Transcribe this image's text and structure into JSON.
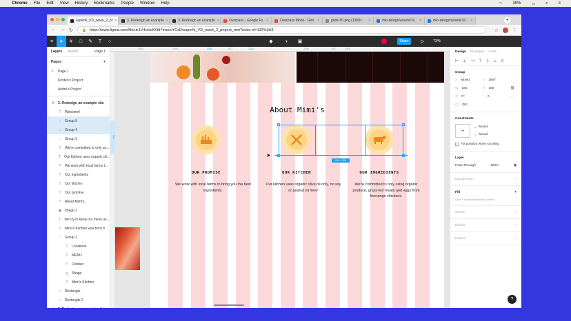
{
  "menubar": {
    "app": "Chrome",
    "items": [
      "File",
      "Edit",
      "View",
      "History",
      "Bookmarks",
      "People",
      "Window",
      "Help"
    ],
    "battery": "39%",
    "clock": "Q"
  },
  "browser": {
    "tabs": [
      {
        "label": "superhi_VD_week_2_pr",
        "color": "#1e1e1e",
        "active": true
      },
      {
        "label": "3. Redesign an example",
        "color": "#2b2b2b",
        "active": false
      },
      {
        "label": "3. Redesign an example",
        "color": "#2b2b2b",
        "active": false
      },
      {
        "label": "Overpass - Google Fo",
        "color": "#e9453a",
        "active": false
      },
      {
        "label": "Overpass Mono - Goo",
        "color": "#e9453a",
        "active": false
      },
      {
        "label": "grids-50.png (1300×",
        "color": "#888888",
        "active": false
      },
      {
        "label": "mio-design/assets/10",
        "color": "#1a73e8",
        "active": false
      },
      {
        "label": "mio-design/assets/10",
        "color": "#1a73e8",
        "active": false
      }
    ],
    "url": "https://www.figma.com/file/uk1V4cetcKKfd7mwcvYCsD/superhi_VD_week_2_project_mm?node-id=132%3A3"
  },
  "figma": {
    "file_title": "",
    "share_label": "Share",
    "zoom": "73%",
    "left_tabs": {
      "layers": "Layers",
      "assets": "Assets",
      "page": "Page 1"
    },
    "pages_label": "Pages",
    "pages": [
      "Page 1",
      "Kirsten's Project",
      "André's Project"
    ],
    "layers": [
      {
        "label": "3. Redesign an example site",
        "icon": "#",
        "indent": 0,
        "frame": true,
        "hl": false
      },
      {
        "label": "Welcome!",
        "icon": "T",
        "indent": 1,
        "frame": false,
        "hl": false
      },
      {
        "label": "Group 5",
        "icon": "::",
        "indent": 1,
        "frame": false,
        "hl": true
      },
      {
        "label": "Group 4",
        "icon": "::",
        "indent": 1,
        "frame": false,
        "hl": true
      },
      {
        "label": "Group 3",
        "icon": "::",
        "indent": 1,
        "frame": false,
        "hl": false
      },
      {
        "label": "We're committed to only us...",
        "icon": "T",
        "indent": 1,
        "frame": false,
        "hl": false
      },
      {
        "label": "Our kitchen uses organic oli...",
        "icon": "T",
        "indent": 1,
        "frame": false,
        "hl": false
      },
      {
        "label": "We work with local farms t...",
        "icon": "T",
        "indent": 1,
        "frame": false,
        "hl": false
      },
      {
        "label": "Our ingredients",
        "icon": "T",
        "indent": 1,
        "frame": false,
        "hl": false
      },
      {
        "label": "Our kitchen",
        "icon": "T",
        "indent": 1,
        "frame": false,
        "hl": false
      },
      {
        "label": "Our promise",
        "icon": "T",
        "indent": 1,
        "frame": false,
        "hl": false
      },
      {
        "label": "About Mimi's",
        "icon": "T",
        "indent": 1,
        "frame": false,
        "hl": false
      },
      {
        "label": "Image 2",
        "icon": "▣",
        "indent": 1,
        "frame": false,
        "hl": false
      },
      {
        "label": "We try to keep our menu as...",
        "icon": "T",
        "indent": 1,
        "frame": false,
        "hl": false
      },
      {
        "label": "Mimi's Kitchen was born fr...",
        "icon": "T",
        "indent": 1,
        "frame": false,
        "hl": false
      },
      {
        "label": "Group 2",
        "icon": "::",
        "indent": 1,
        "frame": false,
        "hl": false
      },
      {
        "label": "Locations",
        "icon": "T",
        "indent": 2,
        "frame": false,
        "hl": false
      },
      {
        "label": "MENU",
        "icon": "T",
        "indent": 2,
        "frame": false,
        "hl": false
      },
      {
        "label": "Contact",
        "icon": "T",
        "indent": 2,
        "frame": false,
        "hl": false
      },
      {
        "label": "Shape",
        "icon": "◎",
        "indent": 2,
        "frame": false,
        "hl": false
      },
      {
        "label": "Mimi's Kitchen",
        "icon": "T",
        "indent": 2,
        "frame": false,
        "hl": false
      },
      {
        "label": "Rectangle",
        "icon": "□",
        "indent": 1,
        "frame": false,
        "hl": false
      },
      {
        "label": "Rectangle 2",
        "icon": "□",
        "indent": 1,
        "frame": false,
        "hl": false
      },
      {
        "label": "3. Redesign an example site",
        "icon": "#",
        "indent": 0,
        "frame": true,
        "hl": false
      }
    ],
    "ruler_marks": [
      "1800",
      "1900",
      "2000",
      "2077",
      "2100",
      "2200",
      "2257",
      "2300"
    ],
    "ruler_left_mark": "1124",
    "design": {
      "title": "About Mimi's",
      "features": [
        {
          "heading": "OUR PROMISE",
          "body": "We work with local farms to bring you the best ingredients.",
          "icon": "farm-icon"
        },
        {
          "heading": "OUR KITCHEN",
          "body": "Our kitchen uses organic olive oil only, no soy or peanut oil here!",
          "icon": "fork-knife-icon"
        },
        {
          "heading": "OUR INGREDIENTS",
          "body": "We're committed to only using organic produce, grass-fed meats and eggs from freerange chickens.",
          "icon": "cow-icon"
        }
      ],
      "selection_size": "610 × 180",
      "brand_pink": "#fbd9db",
      "brand_yellow": "#fcd484"
    },
    "right": {
      "tabs": {
        "design": "Design",
        "prototype": "Prototype",
        "code": "Code"
      },
      "group_label": "Group",
      "x": "Mixed",
      "y": "1867",
      "w": "180",
      "h": "180",
      "rotation": "0°",
      "radius": "0",
      "extra": "250",
      "constraints_label": "Constraints",
      "constraint_h": "Mixed",
      "constraint_v": "Mixed",
      "fix_label": "Fix position when scrolling",
      "layer_label": "Layer",
      "blend": "Pass Through",
      "opacity": "100%",
      "background": "Background",
      "fill": "Fill",
      "fill_hint": "Click + to replace mixed content",
      "stroke": "Stroke",
      "effects": "Effects",
      "export": "Export"
    },
    "help": "?"
  }
}
